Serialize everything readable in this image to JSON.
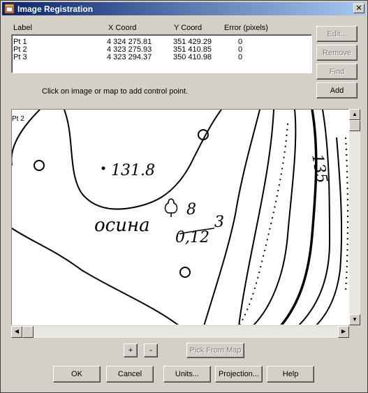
{
  "window": {
    "title": "Image Registration"
  },
  "table": {
    "headers": [
      "Label",
      "X Coord",
      "Y Coord",
      "Error (pixels)"
    ],
    "rows": [
      [
        "Pt 1",
        "4 324 275.81",
        "351 429.29",
        "0"
      ],
      [
        "Pt 2",
        "4 323 275.93",
        "351 410.85",
        "0"
      ],
      [
        "Pt 3",
        "4 323 294.37",
        "350 410.98",
        "0"
      ]
    ]
  },
  "side_buttons": {
    "edit": "Edit...",
    "remove": "Remove",
    "find": "Find",
    "add": "Add"
  },
  "hint": "Click on image or map to add control point.",
  "map": {
    "point_label": "Pt 2",
    "elevation_label": "131.8",
    "tree_label_left": "осина",
    "tree_fraction_top": "8",
    "tree_fraction_bottom": "0,12",
    "tree_fraction_right": "3",
    "contour_label": "135"
  },
  "zoom": {
    "plus": "+",
    "minus": "-"
  },
  "pick_from_map": "Pick From Map",
  "bottom_buttons": {
    "ok": "OK",
    "cancel": "Cancel",
    "units": "Units...",
    "projection": "Projection...",
    "help": "Help"
  }
}
